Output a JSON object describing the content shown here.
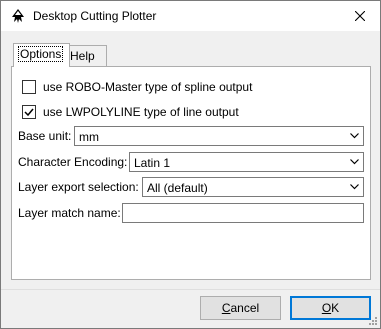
{
  "window": {
    "title": "Desktop Cutting Plotter",
    "close_icon": "close-icon",
    "app_icon": "inkscape-logo-icon"
  },
  "tabs": [
    {
      "label": "Options",
      "active": true
    },
    {
      "label": "Help",
      "active": false
    }
  ],
  "options": {
    "robo_master": {
      "label": "use ROBO-Master type of spline output",
      "checked": false
    },
    "lwpolyline": {
      "label": "use LWPOLYLINE type of line output",
      "checked": true
    },
    "base_unit": {
      "label": "Base unit:",
      "value": "mm"
    },
    "char_encoding": {
      "label": "Character Encoding:",
      "value": "Latin 1"
    },
    "layer_export": {
      "label": "Layer export selection:",
      "value": "All (default)"
    },
    "layer_match": {
      "label": "Layer match name:",
      "value": ""
    }
  },
  "buttons": {
    "cancel": {
      "mnemonic": "C",
      "rest": "ancel"
    },
    "ok": {
      "mnemonic": "O",
      "rest": "K"
    }
  }
}
